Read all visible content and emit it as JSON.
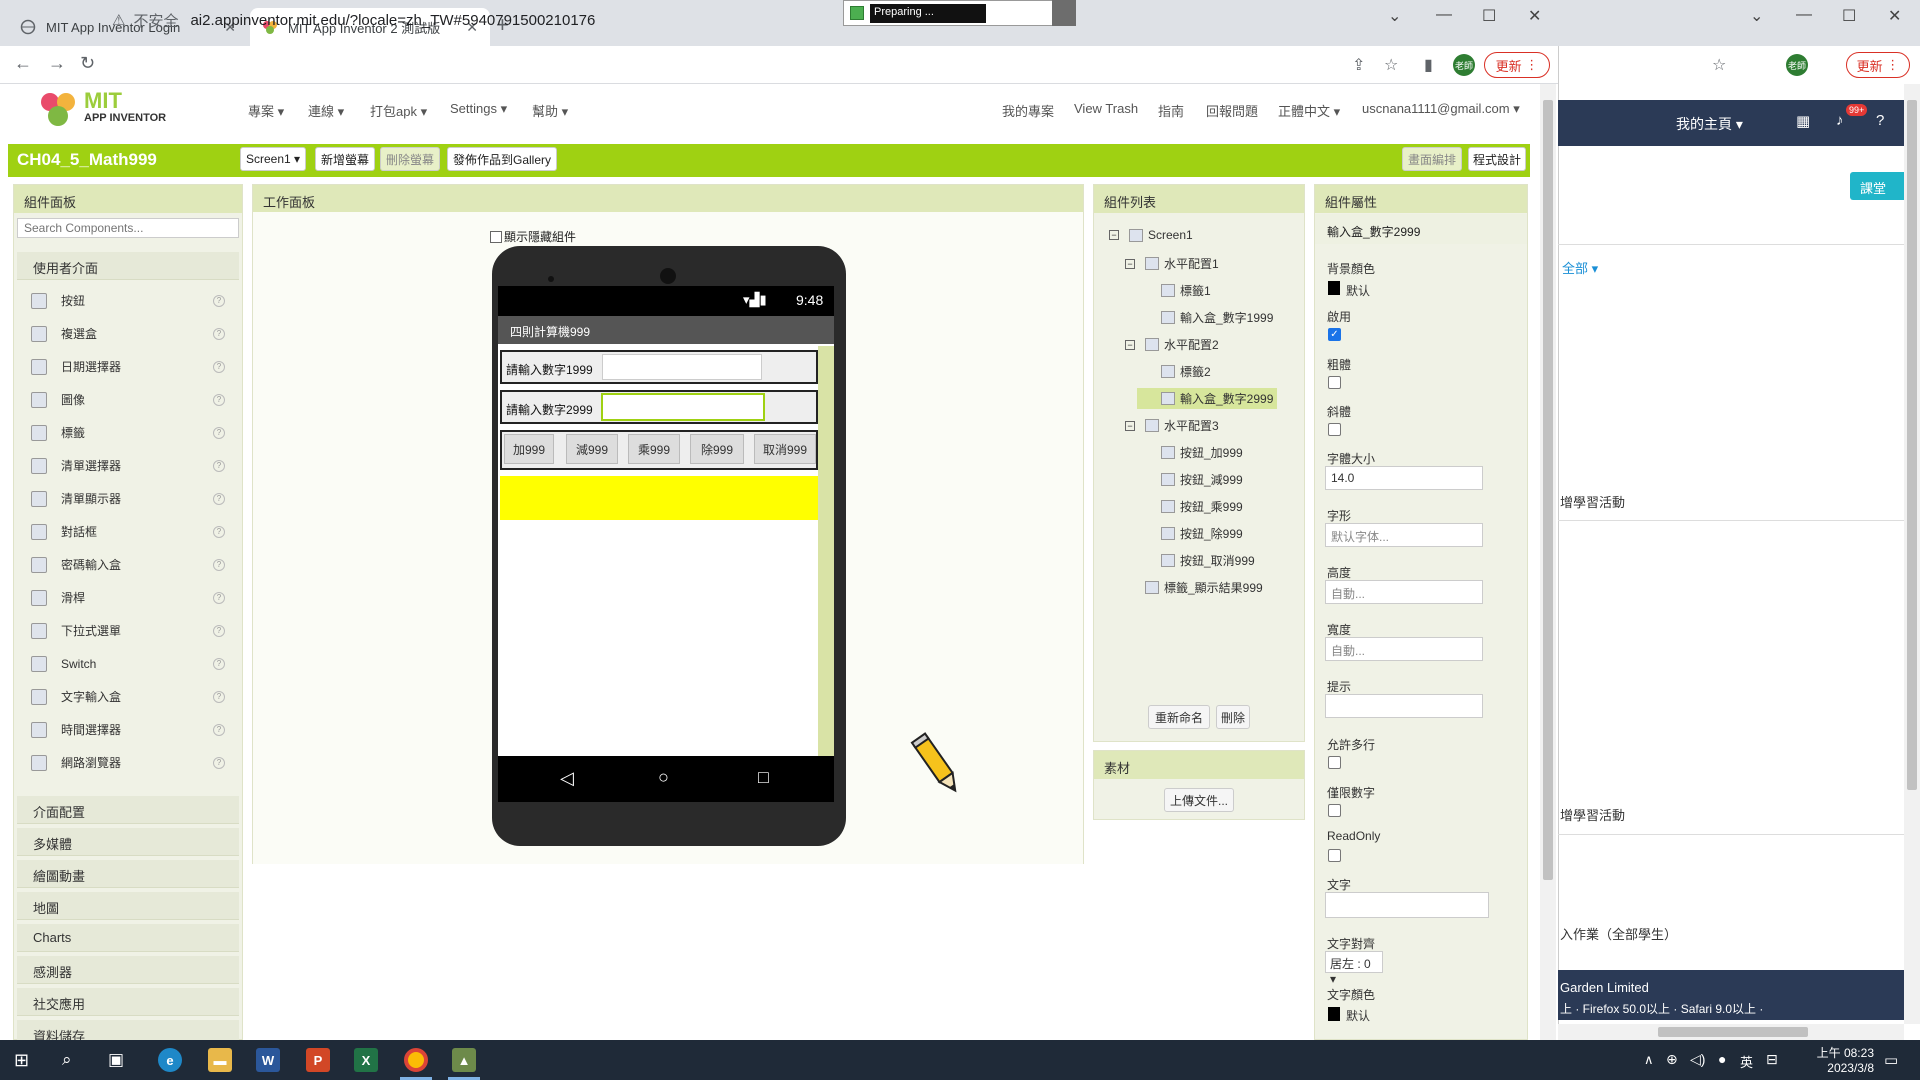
{
  "browser": {
    "tabs": [
      {
        "title": "MIT App Inventor Login",
        "active": false
      },
      {
        "title": "MIT App Inventor 2 測試版",
        "active": true
      }
    ],
    "preparing_text": "Preparing ...",
    "url_warning": "不安全",
    "url": "ai2.appinventor.mit.edu/?locale=zh_TW#5940791500210176",
    "update_label": "更新",
    "avatar_label": "老師"
  },
  "ai_header": {
    "logo_mit": "MIT",
    "logo_sub": "APP INVENTOR",
    "menu_left": [
      "專案 ▾",
      "連線 ▾",
      "打包apk ▾",
      "Settings ▾",
      "幫助 ▾"
    ],
    "menu_right": [
      "我的專案",
      "View Trash",
      "指南",
      "回報問題",
      "正體中文 ▾",
      "uscnana1111@gmail.com ▾"
    ]
  },
  "project_bar": {
    "project_name": "CH04_5_Math999",
    "screen_select": "Screen1 ▾",
    "add_screen": "新增螢幕",
    "remove_screen": "刪除螢幕",
    "publish": "發佈作品到Gallery",
    "designer": "畫面編排",
    "blocks": "程式設計"
  },
  "palette": {
    "title": "組件面板",
    "search_placeholder": "Search Components...",
    "category_open": "使用者介面",
    "items": [
      "按鈕",
      "複選盒",
      "日期選擇器",
      "圖像",
      "標籤",
      "清單選擇器",
      "清單顯示器",
      "對話框",
      "密碼輸入盒",
      "滑桿",
      "下拉式選單",
      "Switch",
      "文字輸入盒",
      "時間選擇器",
      "網路瀏覽器"
    ],
    "categories": [
      "介面配置",
      "多媒體",
      "繪圖動畫",
      "地圖",
      "Charts",
      "感測器",
      "社交應用",
      "資料儲存"
    ]
  },
  "viewer": {
    "title": "工作面板",
    "show_hidden": "顯示隱藏組件",
    "status_time": "9:48",
    "app_title": "四則計算機999",
    "label1": "請輸入數字1999",
    "label2": "請輸入數字2999",
    "buttons": [
      "加999",
      "減999",
      "乘999",
      "除999",
      "取消999"
    ]
  },
  "components": {
    "title": "組件列表",
    "tree": [
      {
        "label": "Screen1",
        "level": 0,
        "toggle": "⊟"
      },
      {
        "label": "水平配置1",
        "level": 1,
        "toggle": "⊟"
      },
      {
        "label": "標籤1",
        "level": 2
      },
      {
        "label": "輸入盒_數字1999",
        "level": 2
      },
      {
        "label": "水平配置2",
        "level": 1,
        "toggle": "⊟"
      },
      {
        "label": "標籤2",
        "level": 2
      },
      {
        "label": "輸入盒_數字2999",
        "level": 2,
        "selected": true
      },
      {
        "label": "水平配置3",
        "level": 1,
        "toggle": "⊟"
      },
      {
        "label": "按鈕_加999",
        "level": 2
      },
      {
        "label": "按鈕_減999",
        "level": 2
      },
      {
        "label": "按鈕_乘999",
        "level": 2
      },
      {
        "label": "按鈕_除999",
        "level": 2
      },
      {
        "label": "按鈕_取消999",
        "level": 2
      },
      {
        "label": "標籤_顯示結果999",
        "level": 1
      }
    ],
    "rename": "重新命名",
    "delete": "刪除"
  },
  "media": {
    "title": "素材",
    "upload": "上傳文件..."
  },
  "properties": {
    "title": "組件屬性",
    "component": "輸入盒_數字2999",
    "bgcolor_label": "背景顏色",
    "bgcolor_value": "默认",
    "enabled_label": "啟用",
    "bold_label": "粗體",
    "italic_label": "斜體",
    "fontsize_label": "字體大小",
    "fontsize_value": "14.0",
    "typeface_label": "字形",
    "typeface_value": "默认字体...",
    "height_label": "高度",
    "height_value": "自動...",
    "width_label": "寬度",
    "width_value": "自動...",
    "hint_label": "提示",
    "multiline_label": "允許多行",
    "numbers_label": "僅限數字",
    "readonly_label": "ReadOnly",
    "text_label": "文字",
    "align_label": "文字對齊",
    "align_value": "居左 : 0 ▾",
    "textcolor_label": "文字顏色",
    "textcolor_value": "默认"
  },
  "right_window": {
    "home": "我的主頁 ▾",
    "badge": "99+",
    "chip": "課堂",
    "filter": "全部 ▾",
    "text1": "增學習活動",
    "text2": "增學習活動",
    "text3": "入作業（全部學生）",
    "footer1": "Garden Limited",
    "footer2": "上 · Firefox 50.0以上 · Safari 9.0以上 ·"
  },
  "taskbar": {
    "time": "上午 08:23",
    "date": "2023/3/8",
    "ime": "英"
  }
}
